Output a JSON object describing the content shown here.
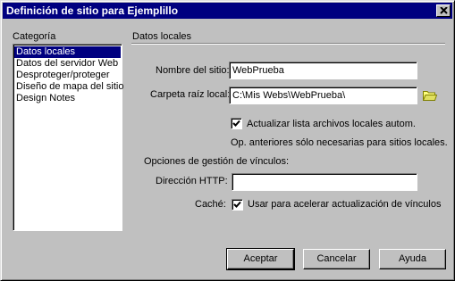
{
  "window": {
    "title": "Definición de sitio para Ejemplillo"
  },
  "sidebar": {
    "heading": "Categoría",
    "items": [
      {
        "label": "Datos locales",
        "selected": true
      },
      {
        "label": "Datos del servidor Web",
        "selected": false
      },
      {
        "label": "Desproteger/proteger",
        "selected": false
      },
      {
        "label": "Diseño de mapa del sitio",
        "selected": false
      },
      {
        "label": "Design Notes",
        "selected": false
      }
    ]
  },
  "panel": {
    "section_title": "Datos locales",
    "site_name": {
      "label": "Nombre del sitio:",
      "value": "WebPrueba"
    },
    "root_folder": {
      "label": "Carpeta raíz local:",
      "value": "C:\\Mis Webs\\WebPrueba\\"
    },
    "auto_refresh": {
      "label": "Actualizar lista archivos locales autom.",
      "checked": true
    },
    "note": "Op. anteriores sólo necesarias para sitios locales.",
    "link_options_heading": "Opciones de gestión de vínculos:",
    "http_address": {
      "label": "Dirección HTTP:",
      "value": ""
    },
    "cache": {
      "label": "Caché:",
      "checkbox_label": "Usar para acelerar actualización de vínculos",
      "checked": true
    }
  },
  "buttons": {
    "ok": "Aceptar",
    "cancel": "Cancelar",
    "help": "Ayuda"
  },
  "icons": {
    "close": "close-icon",
    "folder": "folder-icon",
    "check": "checkmark-icon"
  },
  "colors": {
    "titlebar": "#000080",
    "dialog_face": "#c0c0c0",
    "selection": "#000080"
  }
}
